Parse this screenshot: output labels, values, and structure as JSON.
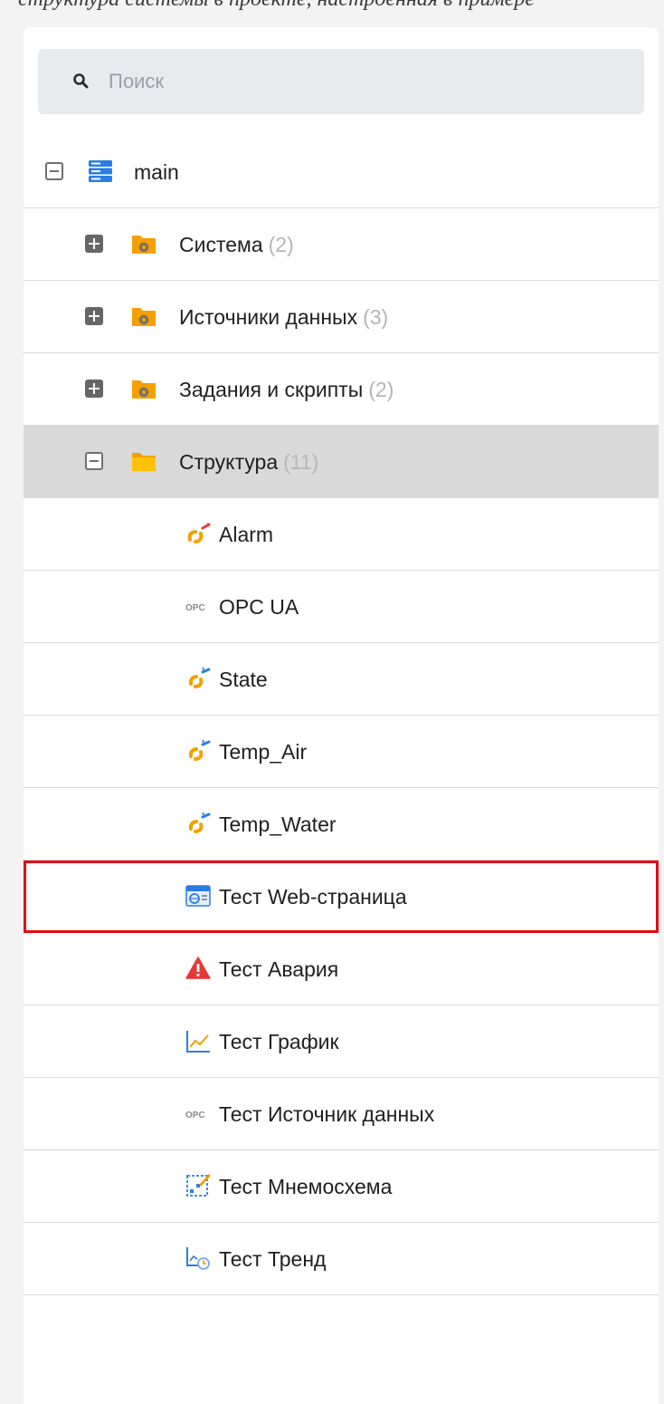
{
  "caption": "структура системы в проекте, настроенная в примере",
  "search": {
    "placeholder": "Поиск",
    "icon": "search-icon"
  },
  "colors": {
    "folder": "#f4a000",
    "server": "#2a7de1",
    "selected_row": "#d9d9d9",
    "highlight_border": "#e50914",
    "count": "#b5b5b5"
  },
  "tree": {
    "root": {
      "label": "main",
      "icon": "server-icon",
      "expanded": true
    },
    "folders": [
      {
        "label": "Система",
        "count": "(2)",
        "icon": "folder-gear-icon",
        "expanded": false
      },
      {
        "label": "Источники данных",
        "count": "(3)",
        "icon": "folder-gear-icon",
        "expanded": false
      },
      {
        "label": "Задания и скрипты",
        "count": "(2)",
        "icon": "folder-gear-icon",
        "expanded": false
      },
      {
        "label": "Структура",
        "count": "(11)",
        "icon": "folder-icon",
        "expanded": true,
        "selected": true
      }
    ],
    "items": [
      {
        "label": "Alarm",
        "icon": "alarm-tag-icon"
      },
      {
        "label": "OPC UA",
        "icon": "opc-icon"
      },
      {
        "label": "State",
        "icon": "tag-icon"
      },
      {
        "label": "Temp_Air",
        "icon": "tag-icon"
      },
      {
        "label": "Temp_Water",
        "icon": "tag-icon"
      },
      {
        "label": "Тест Web-страница",
        "icon": "web-page-icon",
        "highlighted": true
      },
      {
        "label": "Тест Авария",
        "icon": "alarm-icon"
      },
      {
        "label": "Тест График",
        "icon": "chart-icon"
      },
      {
        "label": "Тест Источник данных",
        "icon": "opc-icon"
      },
      {
        "label": "Тест Мнемосхема",
        "icon": "mnemoscheme-icon"
      },
      {
        "label": "Тест Тренд",
        "icon": "trend-icon"
      }
    ]
  }
}
